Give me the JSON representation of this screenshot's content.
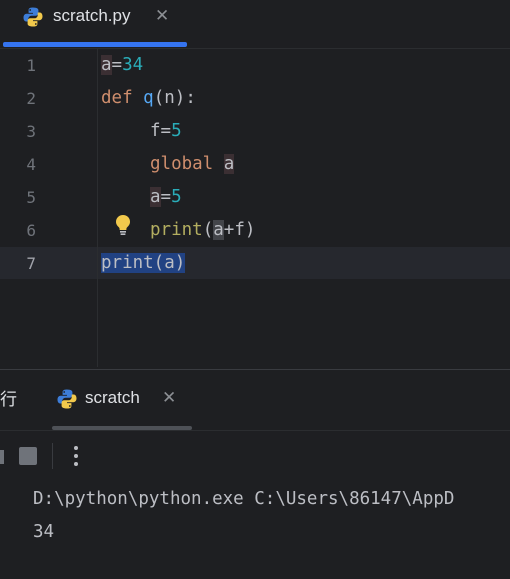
{
  "editor_tab": {
    "label": "scratch.py",
    "close": "✕",
    "icon": "python-icon"
  },
  "editor": {
    "lines": [
      {
        "number": "1"
      },
      {
        "number": "2"
      },
      {
        "number": "3"
      },
      {
        "number": "4"
      },
      {
        "number": "5"
      },
      {
        "number": "6"
      },
      {
        "number": "7"
      }
    ],
    "code": {
      "l1_var": "a",
      "l1_eq": "=",
      "l1_val": "34",
      "l2_kw": "def",
      "l2_fn": "q",
      "l2_open": "(",
      "l2_param": "n",
      "l2_close": "):",
      "l3_var": "f",
      "l3_eq": "=",
      "l3_val": "5",
      "l4_kw": "global",
      "l4_var": "a",
      "l5_var": "a",
      "l5_eq": "=",
      "l5_val": "5",
      "l6_fn": "print",
      "l6_open": "(",
      "l6_a": "a",
      "l6_rest": "+f)",
      "l7_text": "print(a)"
    },
    "colors": {
      "keyword": "#cf8e6d",
      "function": "#56a8f5",
      "number": "#2aacb8",
      "selection": "#214283"
    }
  },
  "run_panel": {
    "title": "行",
    "tab_label": "scratch",
    "tab_close": "✕",
    "tab_icon": "python-icon",
    "output": [
      "D:\\python\\python.exe C:\\Users\\86147\\AppD",
      "34"
    ]
  }
}
